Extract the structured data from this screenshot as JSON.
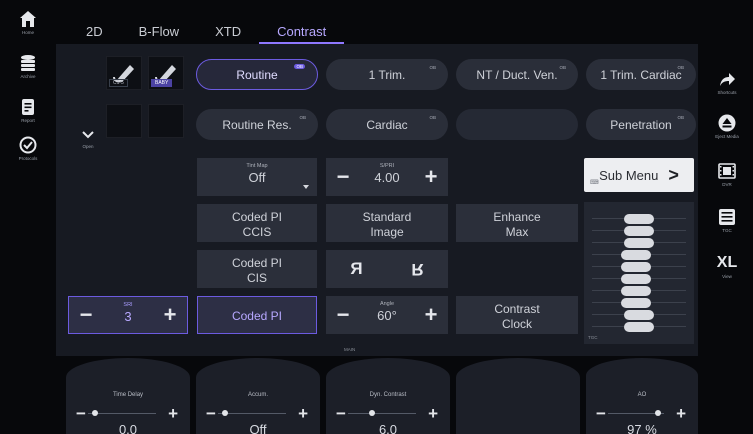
{
  "left_rail": [
    {
      "label": "Home",
      "icon": "home-icon"
    },
    {
      "label": "Archive",
      "icon": "database-icon"
    },
    {
      "label": "Report",
      "icon": "report-icon"
    },
    {
      "label": "Protocols",
      "icon": "checkmark-circle-icon"
    }
  ],
  "right_rail": [
    {
      "label": "Shortcuts",
      "icon": "share-arrow-icon"
    },
    {
      "label": "Eject Media",
      "icon": "eject-icon"
    },
    {
      "label": "DVR",
      "icon": "film-icon"
    },
    {
      "label": "TGC",
      "icon": "keyboard-icon"
    },
    {
      "label": "View",
      "icon_text": "XL"
    }
  ],
  "tabs": [
    {
      "label": "2D"
    },
    {
      "label": "B-Flow"
    },
    {
      "label": "XTD"
    },
    {
      "label": "Contrast",
      "active": true
    }
  ],
  "probes": [
    {
      "tag": "C1-5",
      "selected": false
    },
    {
      "tag": "BABY",
      "selected": true
    }
  ],
  "open_label": "Open",
  "presets": [
    {
      "label": "Routine",
      "badge": "OB",
      "active": true
    },
    {
      "label": "1 Trim.",
      "badge": "OB"
    },
    {
      "label": "NT / Duct. Ven.",
      "badge": "OB"
    },
    {
      "label": "1 Trim. Cardiac",
      "badge": "OB"
    },
    {
      "label": "Routine Res.",
      "badge": "OB"
    },
    {
      "label": "Cardiac",
      "badge": "OB"
    },
    {
      "label": "",
      "badge": ""
    },
    {
      "label": "Penetration",
      "badge": "OB"
    }
  ],
  "controls": {
    "tint_map": {
      "label": "Tint Map",
      "value": "Off"
    },
    "sprf": {
      "label": "S/PRI",
      "value": "4.00"
    },
    "coded_pi_ccis": {
      "line1": "Coded PI",
      "line2": "CCIS"
    },
    "standard_image": {
      "line1": "Standard",
      "line2": "Image"
    },
    "enhance": {
      "line1": "Enhance",
      "line2": "Max"
    },
    "coded_pi_cis": {
      "line1": "Coded PI",
      "line2": "CIS"
    },
    "flip_left": "Я",
    "flip_right": "R",
    "sri": {
      "label": "SRI",
      "value": "3"
    },
    "coded_pi": {
      "label": "Coded PI"
    },
    "angle": {
      "label": "Angle",
      "value": "60°"
    },
    "contrast_clock": {
      "line1": "Contrast",
      "line2": "Clock"
    },
    "main_label": "MAIN"
  },
  "submenu": {
    "label": "Sub Menu",
    "chevron": ">"
  },
  "tgc": {
    "label": "TGC",
    "levels": [
      0.5,
      0.5,
      0.5,
      0.45,
      0.45,
      0.45,
      0.45,
      0.45,
      0.5,
      0.5
    ]
  },
  "knobs": [
    {
      "label": "Time Delay",
      "value": "0.0",
      "level": 0.1
    },
    {
      "label": "Accum.",
      "value": "Off",
      "level": 0.1
    },
    {
      "label": "Dyn. Contrast",
      "value": "6.0",
      "level": 0.35
    },
    {
      "label": "",
      "value": ""
    },
    {
      "label": "AO",
      "value": "97 %",
      "level": 0.9
    }
  ]
}
